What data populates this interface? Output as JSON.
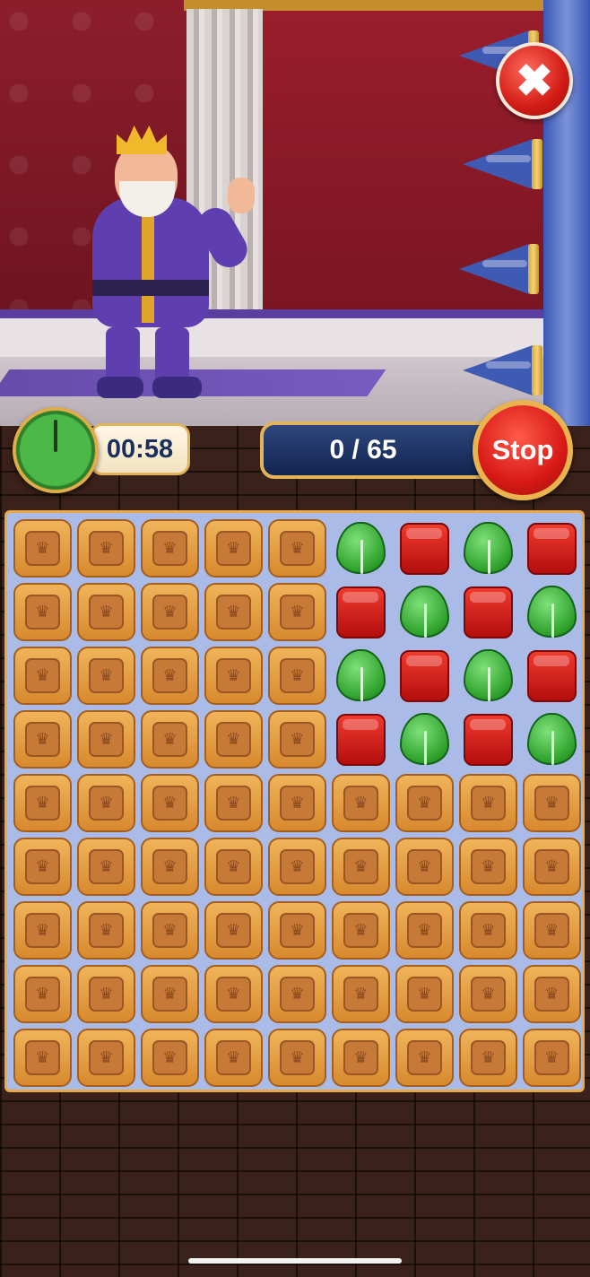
{
  "hud": {
    "timer": "00:58",
    "counter": "0 / 65",
    "stop_label": "Stop",
    "close_icon": "✖"
  },
  "board": {
    "rows": 9,
    "cols": 9,
    "gem_rows": [
      [
        "crate",
        "crate",
        "crate",
        "crate",
        "crate",
        "leaf",
        "red",
        "leaf",
        "red"
      ],
      [
        "crate",
        "crate",
        "crate",
        "crate",
        "crate",
        "red",
        "leaf",
        "red",
        "leaf"
      ],
      [
        "crate",
        "crate",
        "crate",
        "crate",
        "crate",
        "leaf",
        "red",
        "leaf",
        "red"
      ],
      [
        "crate",
        "crate",
        "crate",
        "crate",
        "crate",
        "red",
        "leaf",
        "red",
        "leaf"
      ],
      [
        "crate",
        "crate",
        "crate",
        "crate",
        "crate",
        "crate",
        "crate",
        "crate",
        "crate"
      ],
      [
        "crate",
        "crate",
        "crate",
        "crate",
        "crate",
        "crate",
        "crate",
        "crate",
        "crate"
      ],
      [
        "crate",
        "crate",
        "crate",
        "crate",
        "crate",
        "crate",
        "crate",
        "crate",
        "crate"
      ],
      [
        "crate",
        "crate",
        "crate",
        "crate",
        "crate",
        "crate",
        "crate",
        "crate",
        "crate"
      ],
      [
        "crate",
        "crate",
        "crate",
        "crate",
        "crate",
        "crate",
        "crate",
        "crate",
        "crate"
      ]
    ],
    "crate_icon": "♛"
  },
  "colors": {
    "accent_gold": "#e2b35a",
    "stop_red": "#d71a16",
    "counter_navy": "#12244f"
  }
}
